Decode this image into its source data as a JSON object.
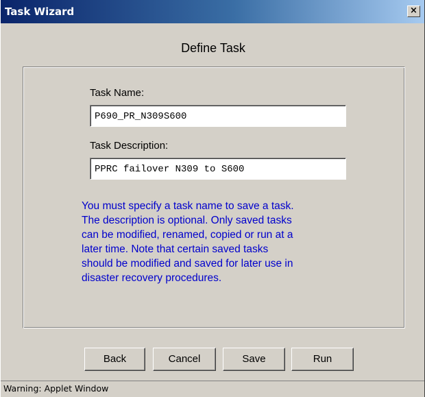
{
  "window": {
    "title": "Task Wizard",
    "close_glyph": "×",
    "close_icon": "close-icon"
  },
  "dialog": {
    "heading": "Define Task",
    "task_name_label": "Task Name:",
    "task_name_value": "P690_PR_N309S600",
    "task_description_label": "Task Description:",
    "task_description_value": "PPRC failover N309 to S600",
    "info_lines": [
      "You must specify a task name to save a task.",
      "The description is optional. Only saved tasks",
      "can be modified, renamed, copied or run at a",
      "later time. Note that certain saved tasks",
      "should be modified and saved for later use in",
      "disaster recovery procedures."
    ]
  },
  "buttons": {
    "back": "Back",
    "cancel": "Cancel",
    "save": "Save",
    "run": "Run"
  },
  "status_bar": {
    "text": "Warning: Applet Window"
  },
  "colors": {
    "titlebar_start": "#0a246a",
    "titlebar_end": "#a6caf0",
    "info_text": "#0000cc",
    "window_bg": "#d4d0c8"
  }
}
